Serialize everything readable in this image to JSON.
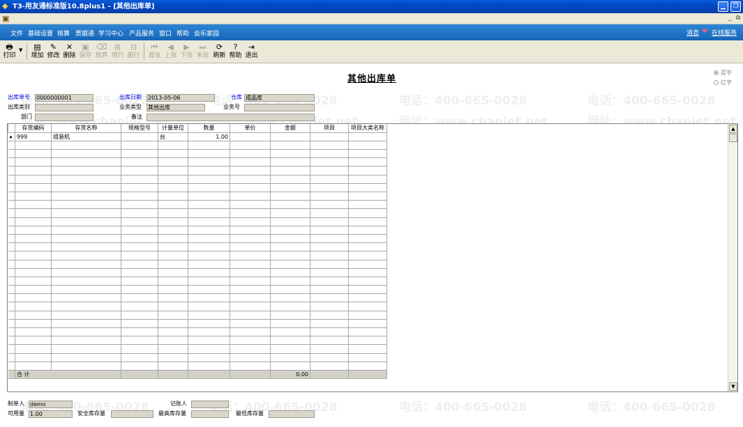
{
  "window": {
    "title": "T3-用友通标准版10.8plus1 - [其他出库单]"
  },
  "menu": {
    "items": [
      "文件",
      "基础设置",
      "核算",
      "票据通",
      "学习中心",
      "产品服务",
      "窗口",
      "帮助",
      "会乐家园"
    ],
    "message": "消息",
    "online_service": "在线服务"
  },
  "toolbar": {
    "buttons": [
      {
        "label": "打印",
        "icon": "printer-icon",
        "enabled": true
      },
      {
        "label": "增加",
        "icon": "add-doc-icon",
        "enabled": true
      },
      {
        "label": "修改",
        "icon": "edit-icon",
        "enabled": true
      },
      {
        "label": "删除",
        "icon": "delete-x-icon",
        "enabled": true
      },
      {
        "label": "保存",
        "icon": "save-icon",
        "enabled": false
      },
      {
        "label": "放弃",
        "icon": "discard-icon",
        "enabled": false
      },
      {
        "label": "增行",
        "icon": "add-row-icon",
        "enabled": false
      },
      {
        "label": "删行",
        "icon": "delete-row-icon",
        "enabled": false
      },
      {
        "label": "首张",
        "icon": "first-icon",
        "enabled": false
      },
      {
        "label": "上张",
        "icon": "prev-icon",
        "enabled": false
      },
      {
        "label": "下张",
        "icon": "next-icon",
        "enabled": false
      },
      {
        "label": "末张",
        "icon": "last-icon",
        "enabled": false
      },
      {
        "label": "刷新",
        "icon": "refresh-icon",
        "enabled": true
      },
      {
        "label": "帮助",
        "icon": "help-icon",
        "enabled": true
      },
      {
        "label": "退出",
        "icon": "exit-icon",
        "enabled": true
      }
    ]
  },
  "form": {
    "title": "其他出库单",
    "color_options": [
      "蓝字",
      "红字"
    ],
    "selected_color": "蓝字",
    "fields": {
      "doc_no": {
        "label": "出库单号",
        "value": "0000000001"
      },
      "doc_date": {
        "label": "出库日期",
        "value": "2013-05-06"
      },
      "warehouse": {
        "label": "仓库",
        "value": "成品库"
      },
      "out_type": {
        "label": "出库类别",
        "value": ""
      },
      "biz_type": {
        "label": "业务类型",
        "value": "其他出库"
      },
      "biz_no": {
        "label": "业务号",
        "value": ""
      },
      "dept": {
        "label": "部门",
        "value": ""
      },
      "remark": {
        "label": "备注",
        "value": ""
      }
    }
  },
  "grid": {
    "columns": [
      "存货编码",
      "存货名称",
      "规格型号",
      "计量单位",
      "数量",
      "单价",
      "金额",
      "项目",
      "项目大类名称"
    ],
    "rows": [
      [
        "999",
        "组装机",
        "",
        "台",
        "1.00",
        "",
        "",
        "",
        ""
      ]
    ],
    "total_label": "合  计",
    "total_amount": "0.00"
  },
  "footer": {
    "maker": {
      "label": "制单人",
      "value": "demo"
    },
    "bookkeeper": {
      "label": "记账人",
      "value": ""
    },
    "available_qty": {
      "label": "可用量",
      "value": "1.00"
    },
    "safety_stock": {
      "label": "安全库存量",
      "value": ""
    },
    "max_stock": {
      "label": "最高库存量",
      "value": ""
    },
    "min_stock": {
      "label": "最低库存量",
      "value": ""
    }
  },
  "watermark": {
    "phone": "电话：400-665-0028",
    "site": "网址：www.chanjet.net"
  },
  "colors": {
    "title_bar": "#0148c4",
    "menu_bar": "#1f74c8",
    "toolbar": "#ece9d8",
    "label_blue": "#0000e6",
    "field_bg": "#d9d6cb"
  }
}
